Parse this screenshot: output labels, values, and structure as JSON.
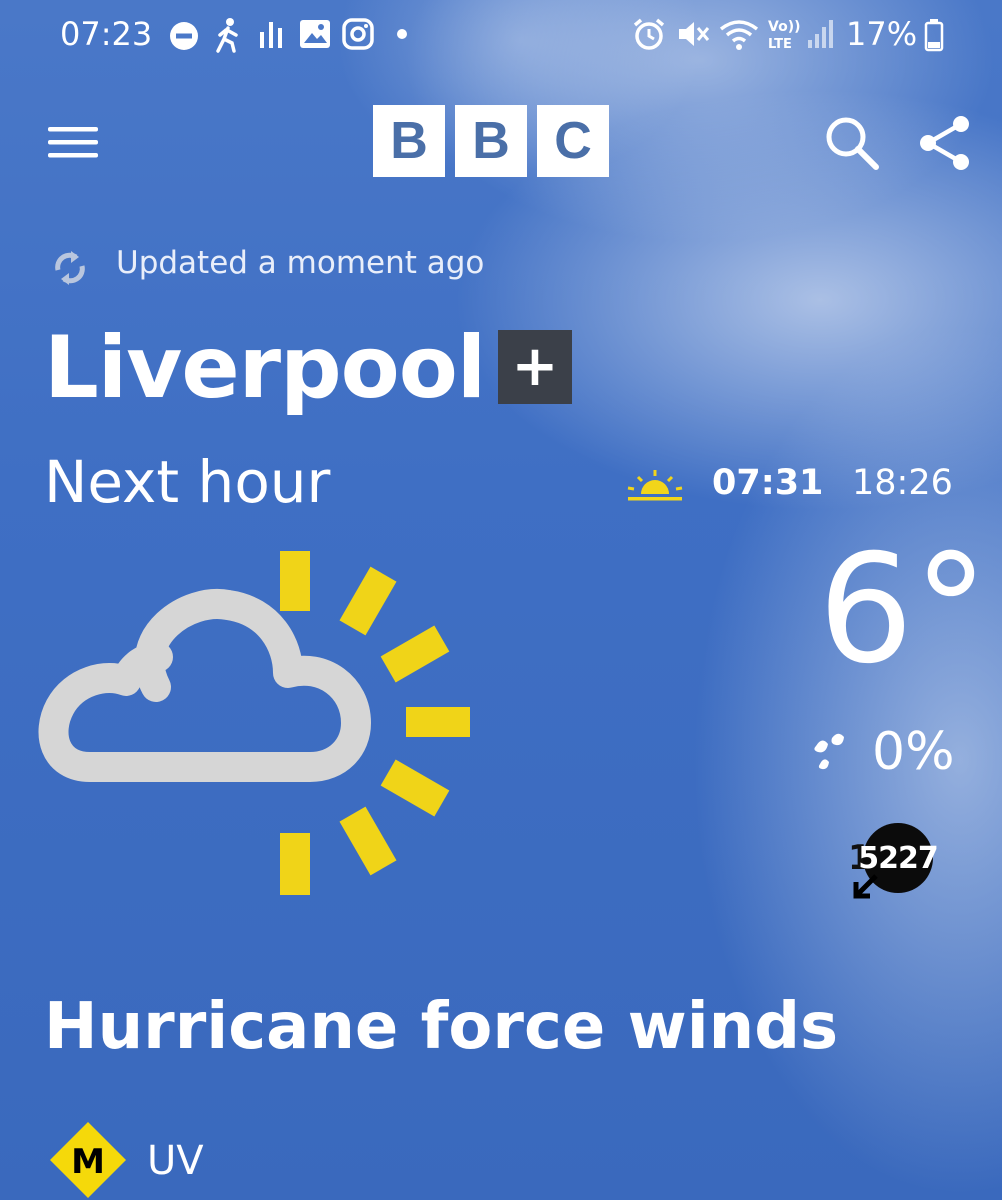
{
  "status_bar": {
    "time": "07:23",
    "battery": "17%"
  },
  "header": {
    "logo_letters": [
      "B",
      "B",
      "C"
    ]
  },
  "updated": {
    "text": "Updated a moment ago"
  },
  "location": {
    "name": "Liverpool",
    "add_symbol": "+"
  },
  "forecast": {
    "period_label": "Next hour",
    "sunrise": "07:31",
    "sunset": "18:26",
    "temperature": "6°",
    "precipitation": "0%",
    "wind_speed": "15",
    "wind_gust_badge": "5227",
    "condition_icon": "light-cloud-and-sun-icon",
    "headline": "Hurricane force winds"
  },
  "uv": {
    "level_letter": "M",
    "label": "UV"
  },
  "colors": {
    "sky_blue": "#3f6fc4",
    "sun_yellow": "#f2d51a",
    "cloud_grey": "#d4d4d4",
    "add_button_bg": "#3b4049",
    "uv_moderate": "#f5d90a"
  }
}
